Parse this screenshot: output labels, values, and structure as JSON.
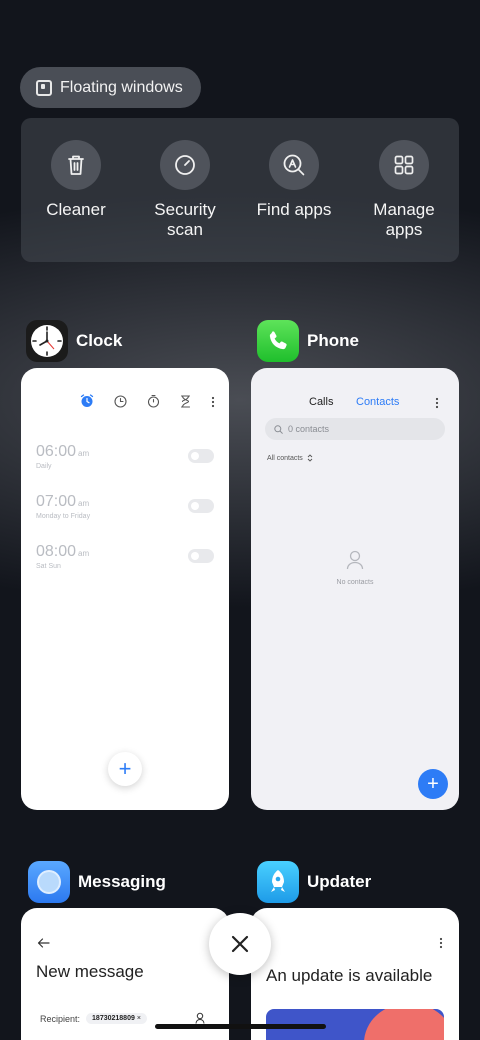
{
  "floating_windows": {
    "label": "Floating windows"
  },
  "quick_actions": [
    {
      "label": "Cleaner",
      "icon": "trash-icon"
    },
    {
      "label": "Security\nscan",
      "icon": "security-scan-icon"
    },
    {
      "label": "Find apps",
      "icon": "find-apps-icon"
    },
    {
      "label": "Manage\napps",
      "icon": "manage-apps-icon"
    }
  ],
  "apps": {
    "clock": {
      "name": "Clock",
      "alarms": [
        {
          "time": "06:00",
          "ampm": "am",
          "repeat": "Daily",
          "enabled": false
        },
        {
          "time": "07:00",
          "ampm": "am",
          "repeat": "Monday to Friday",
          "enabled": false
        },
        {
          "time": "08:00",
          "ampm": "am",
          "repeat": "Sat Sun",
          "enabled": false
        }
      ],
      "add_label": "+"
    },
    "phone": {
      "name": "Phone",
      "tabs": [
        "Calls",
        "Contacts"
      ],
      "active_tab": "Contacts",
      "search_placeholder": "0 contacts",
      "filter_label": "All contacts",
      "empty_label": "No contacts",
      "add_label": "+"
    },
    "messaging": {
      "name": "Messaging",
      "title": "New message",
      "recipient_label": "Recipient:",
      "recipient_chip": "18730218809",
      "chip_remove": "×"
    },
    "updater": {
      "name": "Updater",
      "title": "An update is available"
    }
  },
  "colors": {
    "accent_blue": "#2d7cf6",
    "phone_green": "#22c92f",
    "messaging_blue": "#3b8cf5",
    "updater_cyan": "#1fb4f0"
  }
}
